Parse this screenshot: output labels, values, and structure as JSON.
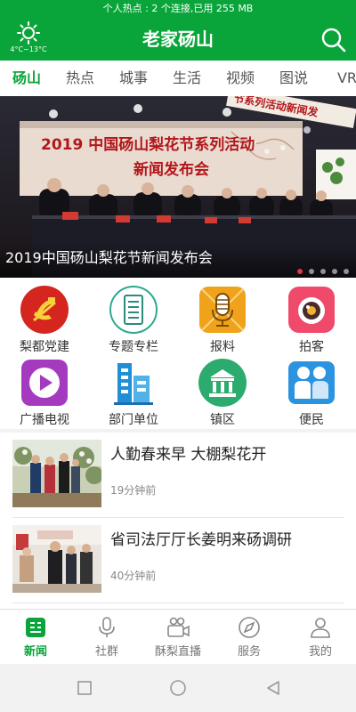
{
  "status_bar": {
    "text": "个人热点 : 2 个连接,已用 255 MB"
  },
  "header": {
    "weather_icon": "sun-icon",
    "weather_temp": "4°C~13°C",
    "title": "老家砀山",
    "search_icon": "search-icon"
  },
  "channels": [
    {
      "label": "砀山"
    },
    {
      "label": "热点"
    },
    {
      "label": "城事"
    },
    {
      "label": "生活"
    },
    {
      "label": "视频"
    },
    {
      "label": "图说"
    },
    {
      "label": "VR"
    }
  ],
  "banner": {
    "caption": "2019中国砀山梨花节新闻发布会",
    "photo_text_line1": "2019 中国砀山梨花节系列活动",
    "photo_text_line2": "新闻发布会",
    "photo_text_top": "节系列活动新闻发",
    "slide_count": 5,
    "active_slide": 1
  },
  "grid_menu": [
    {
      "label": "梨都党建",
      "icon": "party-emblem-icon"
    },
    {
      "label": "专题专栏",
      "icon": "checklist-icon"
    },
    {
      "label": "报料",
      "icon": "microphone-icon"
    },
    {
      "label": "拍客",
      "icon": "camera-icon"
    },
    {
      "label": "广播电视",
      "icon": "play-icon"
    },
    {
      "label": "部门单位",
      "icon": "building-icon"
    },
    {
      "label": "镇区",
      "icon": "government-building-icon"
    },
    {
      "label": "便民",
      "icon": "people-icon"
    }
  ],
  "news": [
    {
      "title": "人勤春来早 大棚梨花开",
      "time": "19分钟前"
    },
    {
      "title": "省司法厅厅长姜明来砀调研",
      "time": "40分钟前"
    }
  ],
  "bottom_nav": [
    {
      "label": "新闻",
      "icon": "news-icon",
      "active": true
    },
    {
      "label": "社群",
      "icon": "microphone-icon"
    },
    {
      "label": "酥梨直播",
      "icon": "video-camera-icon"
    },
    {
      "label": "服务",
      "icon": "compass-icon"
    },
    {
      "label": "我的",
      "icon": "user-icon"
    }
  ],
  "system_nav": [
    "recent-apps-icon",
    "home-icon",
    "back-icon"
  ],
  "colors": {
    "brand": "#0aa53a",
    "accent_red": "#e0383e"
  }
}
